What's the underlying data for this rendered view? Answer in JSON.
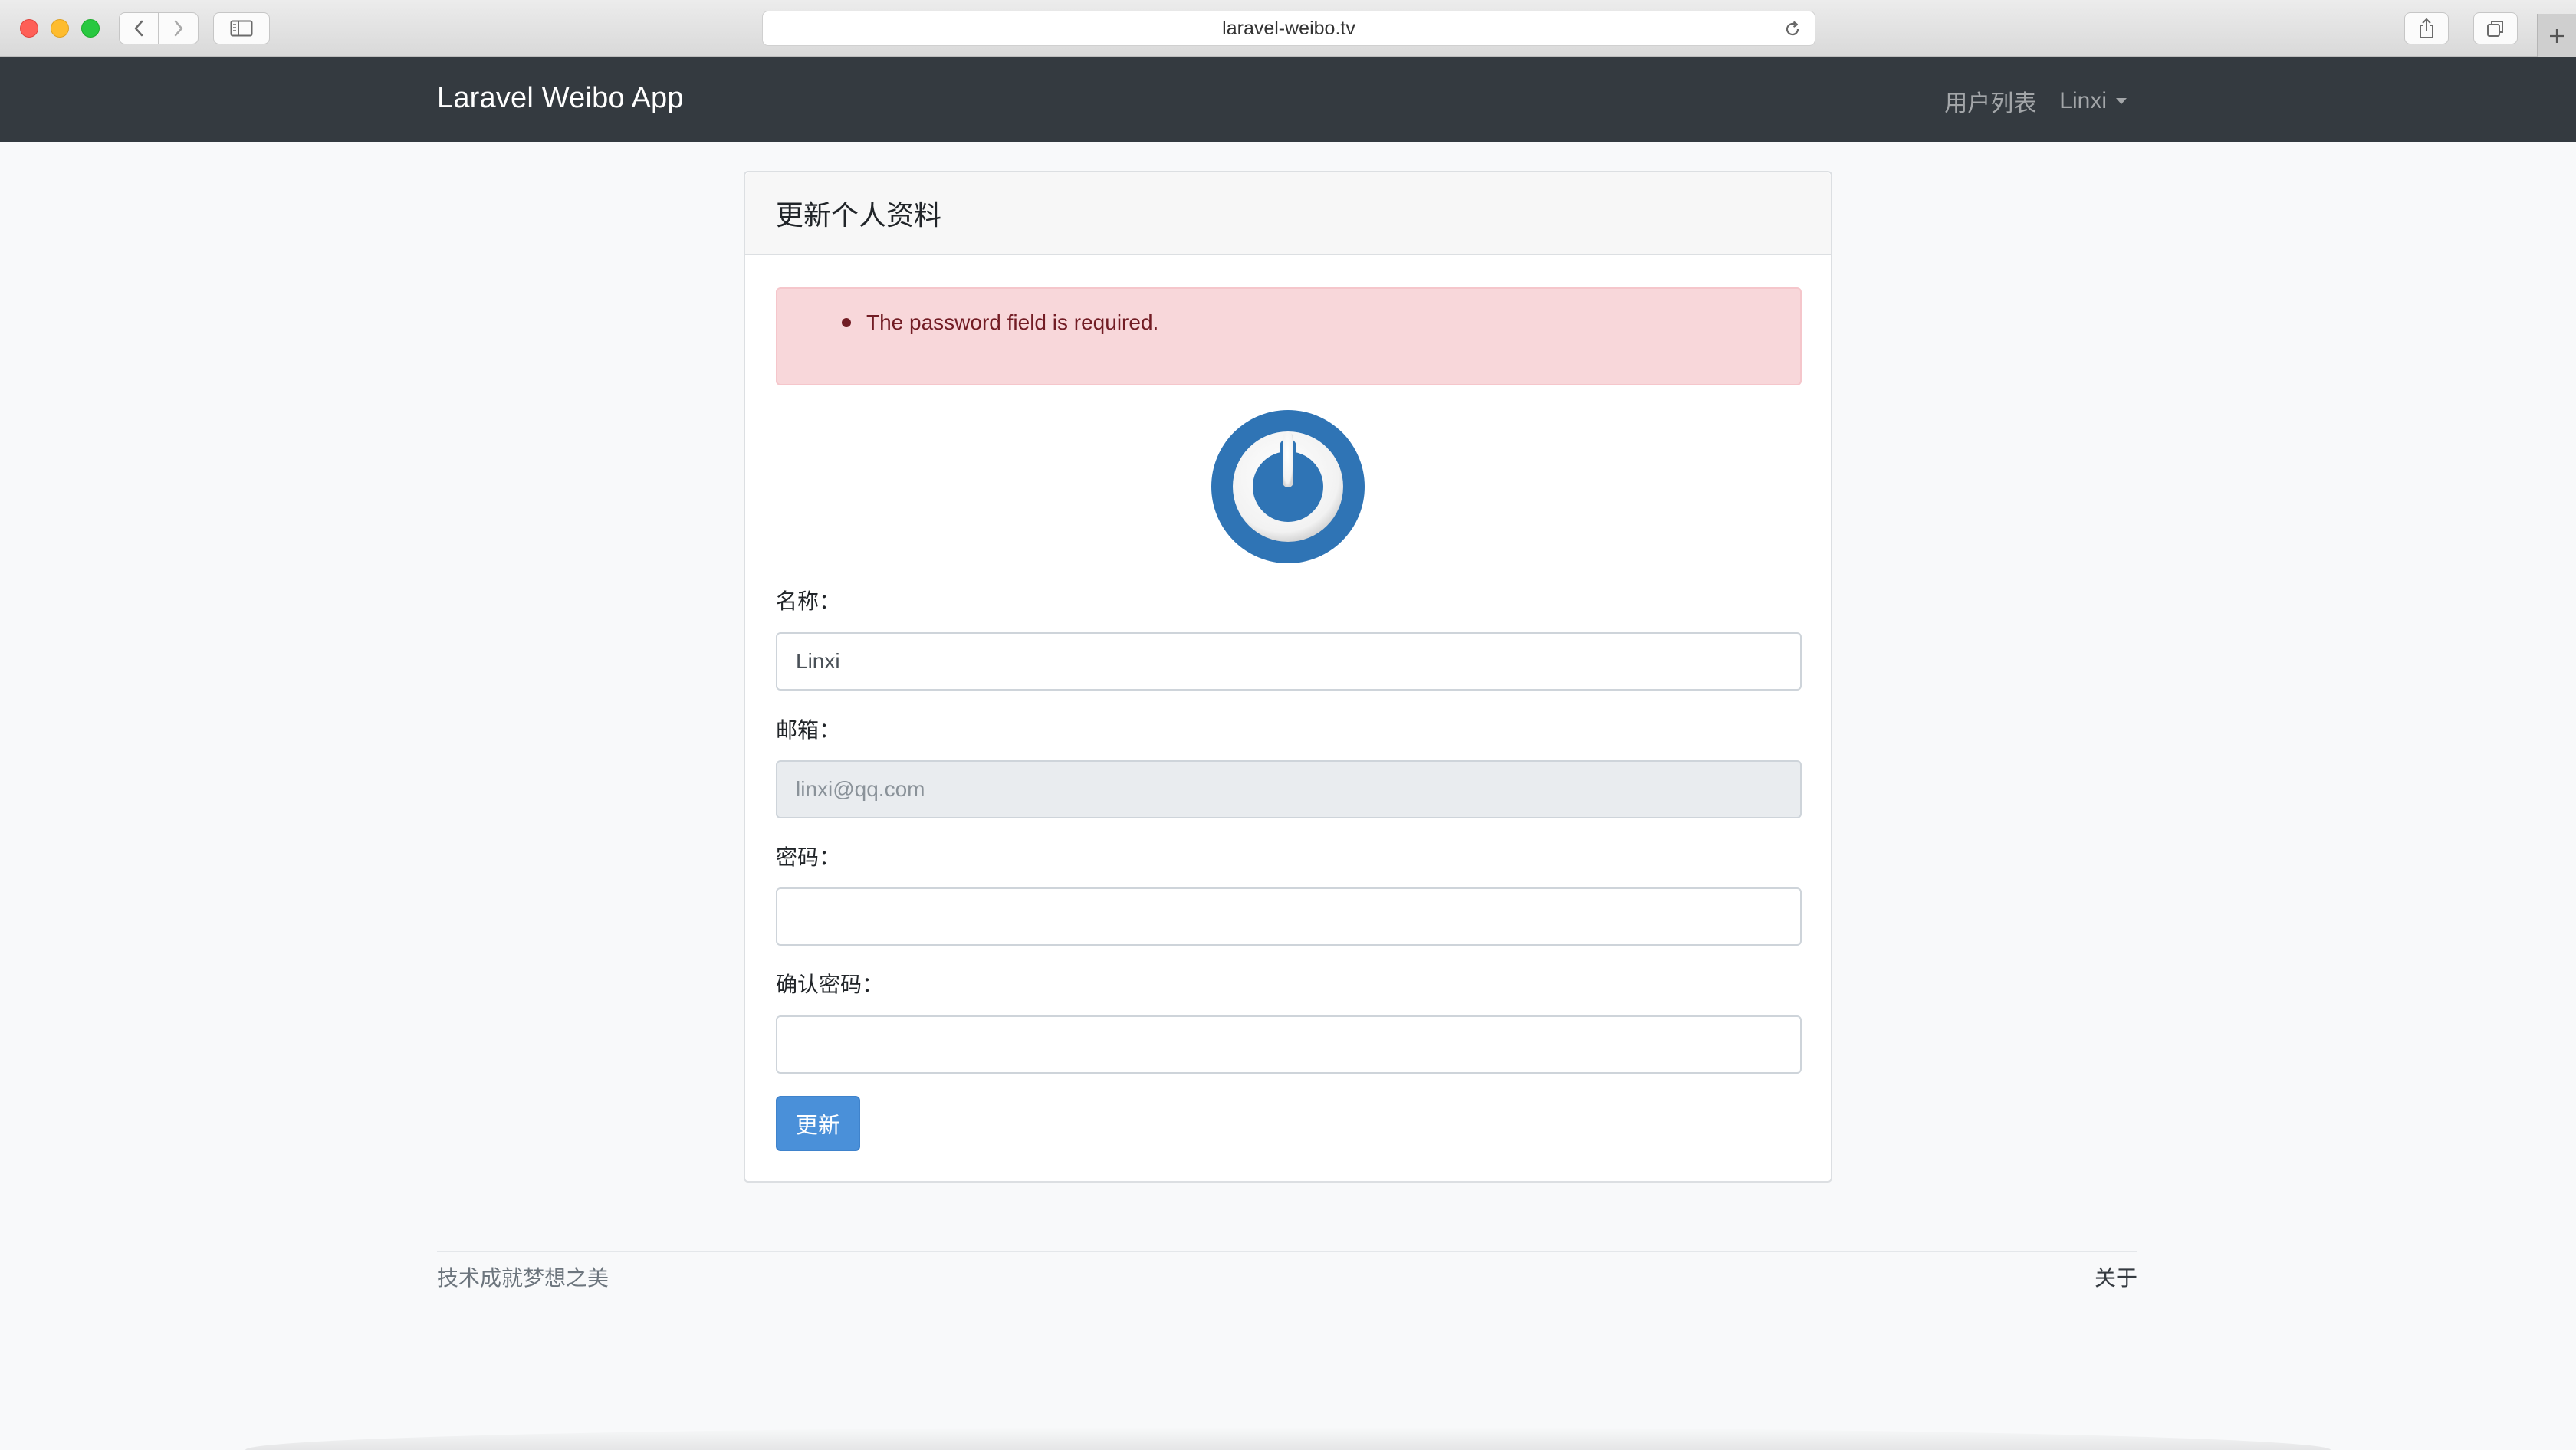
{
  "browser": {
    "url": "laravel-weibo.tv"
  },
  "navbar": {
    "brand": "Laravel Weibo App",
    "users_link": "用户列表",
    "user_menu": "Linxi"
  },
  "card": {
    "title": "更新个人资料",
    "errors": [
      "The password field is required."
    ],
    "avatar_icon": "gravatar-power-icon",
    "avatar_colors": {
      "ring": "#2f74b5",
      "inner": "#ffffff"
    }
  },
  "form": {
    "name_label": "名称：",
    "name_value": "Linxi",
    "email_label": "邮箱：",
    "email_value": "linxi@qq.com",
    "password_label": "密码：",
    "password_value": "",
    "confirm_label": "确认密码：",
    "confirm_value": "",
    "submit_label": "更新"
  },
  "footer": {
    "slogan": "技术成就梦想之美",
    "about_link": "关于"
  },
  "colors": {
    "navbar_bg": "#343a40",
    "alert_bg": "#f8d7da",
    "alert_text": "#721c24",
    "primary_button": "#4a90d9"
  }
}
